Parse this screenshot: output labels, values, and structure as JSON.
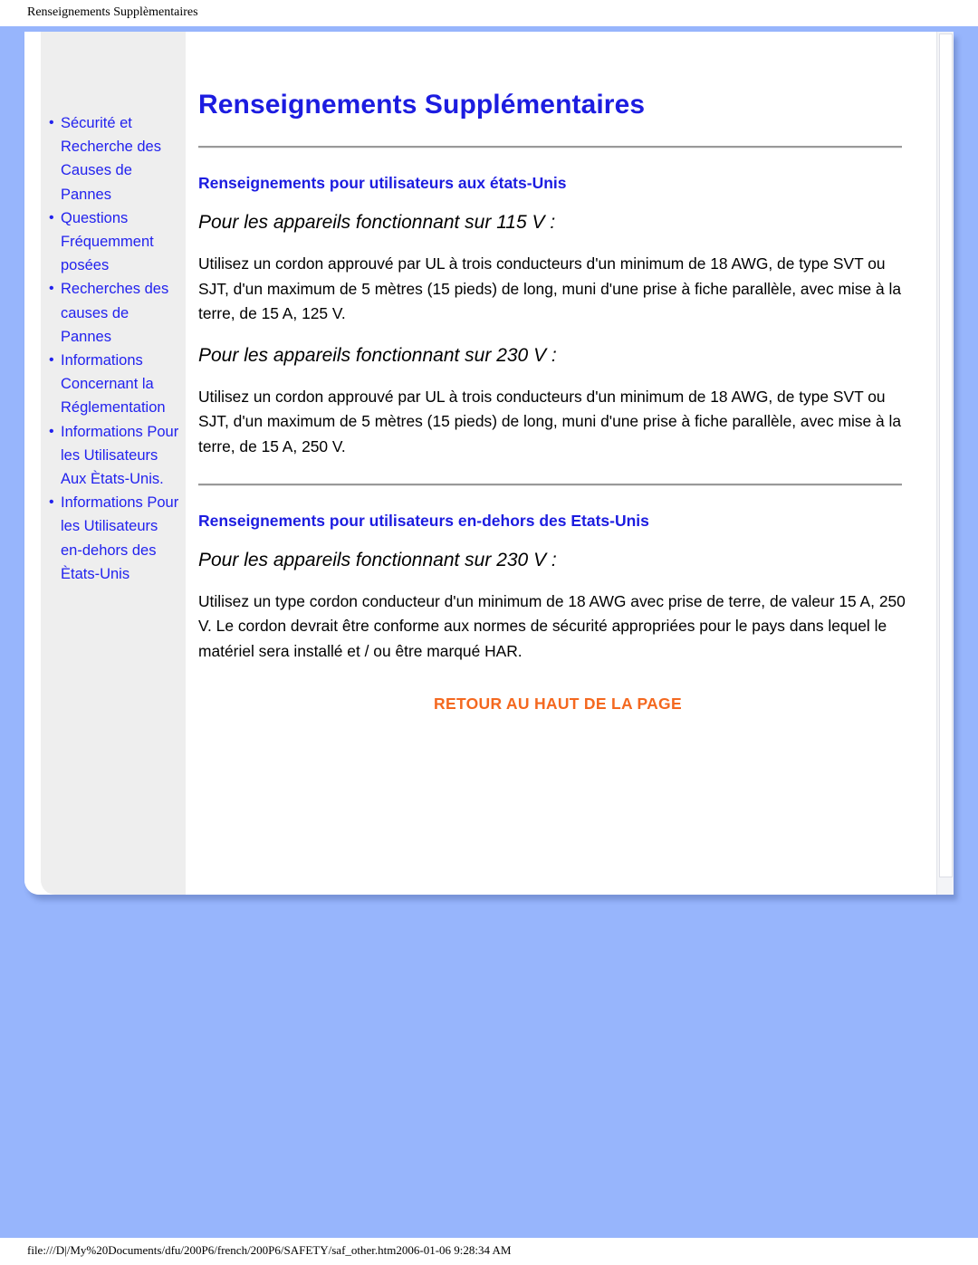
{
  "browser_print_header": "Renseignements Supplèmentaires",
  "browser_print_footer": "file:///D|/My%20Documents/dfu/200P6/french/200P6/SAFETY/saf_other.htm2006-01-06 9:28:34 AM",
  "colors": {
    "page_blue": "#97b5fc",
    "sidebar_bg": "#eeeeee",
    "link_blue": "#2222ee",
    "heading_blue": "#1c1ce0",
    "backtop_orange": "#f4681f",
    "rule_gray": "#999999"
  },
  "sidebar": {
    "items": [
      {
        "bullet": "•",
        "label": "Sécurité et Recherche des Causes de Pannes"
      },
      {
        "bullet": "•",
        "label": "Questions Fréquemment posées"
      },
      {
        "bullet": "•",
        "label": "Recherches des causes de Pannes"
      },
      {
        "bullet": "•",
        "label": "Informations Concernant la Réglementation"
      },
      {
        "bullet": "•",
        "label": "Informations Pour les Utilisateurs Aux Ètats-Unis."
      },
      {
        "bullet": "•",
        "label": "Informations Pour les Utilisateurs en-dehors des Ètats-Unis"
      }
    ]
  },
  "main": {
    "title": "Renseignements Supplémentaires",
    "sections": [
      {
        "heading": "Renseignements pour utilisateurs aux états-Unis",
        "sub1": "Pour les appareils fonctionnant sur 115 V :",
        "body1": "Utilisez un cordon approuvé par UL à trois conducteurs d'un minimum de 18 AWG, de type SVT ou SJT, d'un maximum de 5 mètres (15 pieds) de long, muni d'une prise à fiche parallèle, avec mise à la terre, de 15 A, 125 V.",
        "sub2": "Pour les appareils fonctionnant sur 230 V :",
        "body2": "Utilisez un cordon approuvé par UL à trois conducteurs d'un minimum de 18 AWG, de type SVT ou SJT, d'un maximum de 5 mètres (15 pieds) de long, muni d'une prise à fiche parallèle, avec mise à la terre, de 15 A, 250 V."
      },
      {
        "heading": "Renseignements pour utilisateurs en-dehors des Etats-Unis",
        "sub1": "Pour les appareils fonctionnant sur 230 V :",
        "body1": "Utilisez un type cordon conducteur d'un minimum de 18 AWG avec prise de terre, de valeur 15 A, 250 V. Le cordon devrait être conforme aux normes de sécurité appropriées pour le pays dans lequel le matériel sera installé et / ou être marqué HAR."
      }
    ],
    "back_to_top": "RETOUR AU HAUT DE LA PAGE"
  }
}
